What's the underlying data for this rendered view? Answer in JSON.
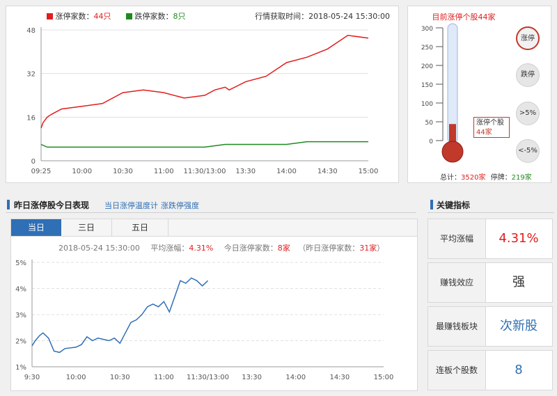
{
  "colors": {
    "limit_up": "#e11d1d",
    "limit_down": "#1e8a1e",
    "accent_blue": "#2f6fb5",
    "temp_red": "#c0392b"
  },
  "top_chart": {
    "legend_up_label": "涨停家数：",
    "legend_up_value": "44只",
    "legend_down_label": "跌停家数：",
    "legend_down_value": "8只",
    "time_label": "行情获取时间：2018-05-24 15:30:00"
  },
  "thermo": {
    "title": "目前涨停个股44家",
    "tooltip_line1": "涨停个股",
    "tooltip_line2": "44家",
    "total_label": "总计：",
    "total_value": "3520家",
    "halt_label": "停牌：",
    "halt_value": "219家",
    "buttons": [
      "涨停",
      "跌停",
      ">5%",
      "<-5%"
    ],
    "value": 44,
    "max": 300,
    "ticks": [
      "300",
      "250",
      "200",
      "150",
      "100",
      "50",
      "0"
    ]
  },
  "bottom": {
    "title": "昨日涨停股今日表现",
    "link1": "当日涨停温度计",
    "link2": "涨跌停强度",
    "tabs": [
      "当日",
      "三日",
      "五日"
    ],
    "info_time": "2018-05-24 15:30:00",
    "avg_label": "平均涨幅：",
    "avg_value": "4.31%",
    "today_label": "今日涨停家数：",
    "today_value": "8家",
    "yesterday_label": "（昨日涨停家数：",
    "yesterday_value": "31家",
    "yesterday_close": "）"
  },
  "key_metrics": {
    "title": "关键指标",
    "items": [
      {
        "label": "平均涨幅",
        "value": "4.31%"
      },
      {
        "label": "赚钱效应",
        "value": "强"
      },
      {
        "label": "最赚钱板块",
        "value": "次新股"
      },
      {
        "label": "连板个股数",
        "value": "8"
      }
    ]
  },
  "chart_data": [
    {
      "type": "line",
      "x_ticks": [
        "09:25",
        "10:00",
        "10:30",
        "11:00",
        "11:30/13:00",
        "13:30",
        "14:00",
        "14:30",
        "15:00"
      ],
      "ylim": [
        0,
        48
      ],
      "y_ticks": [
        0,
        16,
        32,
        48
      ],
      "grid": true,
      "series": [
        {
          "name": "涨停家数",
          "color": "#e11d1d",
          "x": [
            0,
            0.1,
            0.3,
            0.5,
            1,
            2,
            3,
            4,
            5,
            6,
            7,
            8,
            8.5,
            9,
            9.2,
            10,
            11,
            12,
            13,
            14,
            15,
            16
          ],
          "values": [
            12,
            14,
            16,
            17,
            19,
            20,
            21,
            25,
            26,
            25,
            23,
            24,
            26,
            27,
            26,
            29,
            31,
            36,
            38,
            41,
            46,
            45
          ]
        },
        {
          "name": "跌停家数",
          "color": "#1e8a1e",
          "x": [
            0,
            0.3,
            1,
            4,
            8,
            9,
            10,
            11,
            12,
            13,
            14,
            15,
            16
          ],
          "values": [
            6,
            5,
            5,
            5,
            5,
            6,
            6,
            6,
            6,
            7,
            7,
            7,
            7
          ]
        }
      ]
    },
    {
      "type": "line",
      "x_ticks": [
        "9:30",
        "10:00",
        "10:30",
        "11:00",
        "11:30/13:00",
        "13:30",
        "14:00",
        "14:30",
        "15:00"
      ],
      "ylim": [
        1,
        5
      ],
      "y_ticks": [
        "1%",
        "2%",
        "3%",
        "4%",
        "5%"
      ],
      "grid": true,
      "series": [
        {
          "name": "平均涨幅",
          "color": "#2f6fb5",
          "x": [
            0,
            0.15,
            0.35,
            0.5,
            0.75,
            1,
            1.25,
            1.5,
            2,
            2.25,
            2.5,
            2.75,
            3,
            3.25,
            3.5,
            3.75,
            4,
            4.25,
            4.5,
            4.75,
            5,
            5.25,
            5.5,
            5.75,
            6,
            6.25,
            6.5,
            6.75,
            7,
            7.25,
            7.5,
            7.75,
            8
          ],
          "values": [
            1.8,
            2.0,
            2.2,
            2.3,
            2.1,
            1.6,
            1.55,
            1.7,
            1.75,
            1.85,
            2.15,
            2.0,
            2.1,
            2.05,
            2.0,
            2.1,
            1.9,
            2.3,
            2.7,
            2.8,
            3.0,
            3.3,
            3.4,
            3.3,
            3.5,
            3.1,
            3.7,
            4.3,
            4.2,
            4.4,
            4.3,
            4.1,
            4.3
          ]
        }
      ]
    }
  ]
}
